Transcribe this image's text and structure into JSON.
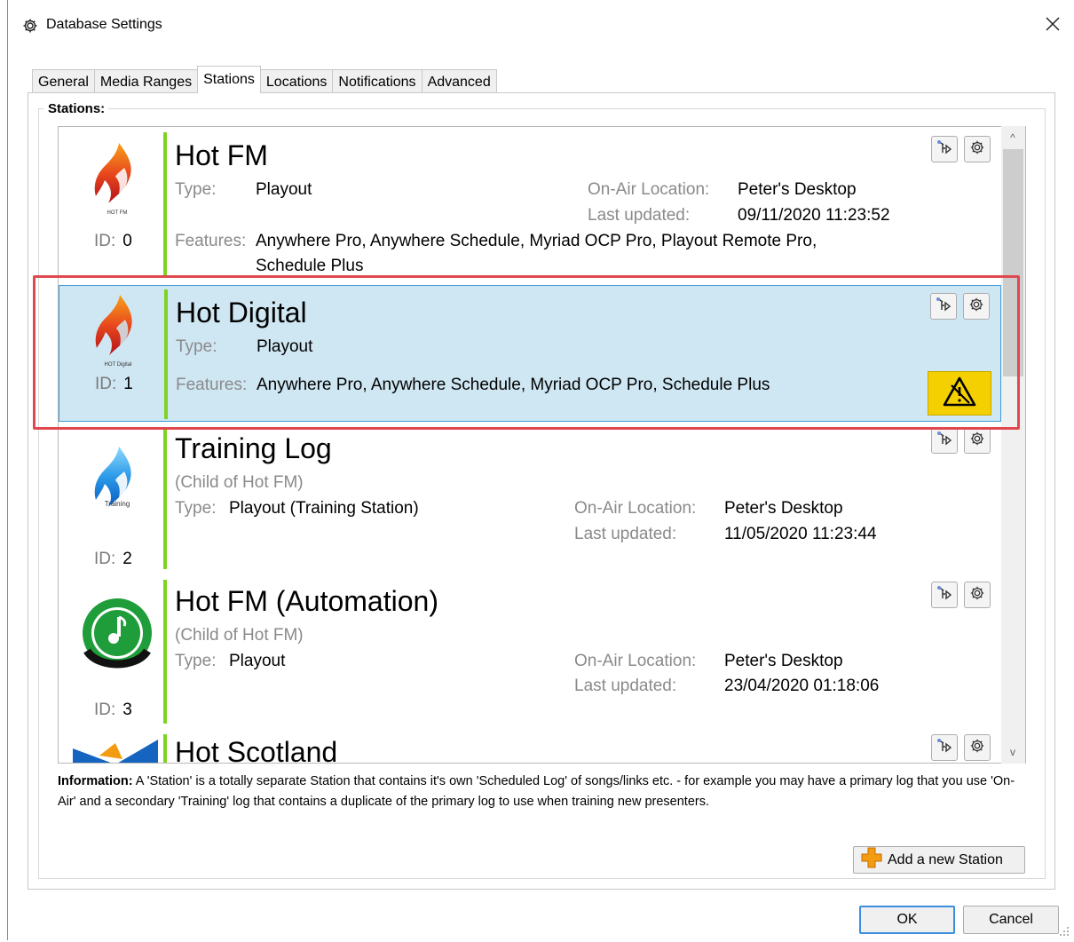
{
  "window": {
    "title": "Database Settings"
  },
  "tabs": [
    {
      "label": "General"
    },
    {
      "label": "Media Ranges"
    },
    {
      "label": "Stations"
    },
    {
      "label": "Locations"
    },
    {
      "label": "Notifications"
    },
    {
      "label": "Advanced"
    }
  ],
  "group_label": "Stations:",
  "labels": {
    "id": "ID:",
    "type": "Type:",
    "features": "Features:",
    "onair_location": "On-Air Location:",
    "last_updated": "Last updated:"
  },
  "stations": [
    {
      "name": "Hot FM",
      "logo_caption": "HOT FM",
      "id": "0",
      "type": "Playout",
      "onair_location": "Peter's Desktop",
      "last_updated": "09/11/2020 11:23:52",
      "features_line1": "Anywhere Pro, Anywhere Schedule, Myriad OCP Pro, Playout Remote Pro,",
      "features_line2": "Schedule Plus"
    },
    {
      "name": "Hot Digital",
      "logo_caption": "HOT Digital",
      "id": "1",
      "type": "Playout",
      "features_line1": "Anywhere Pro, Anywhere Schedule, Myriad OCP Pro, Schedule Plus",
      "selected": true,
      "warning": true
    },
    {
      "name": "Training Log",
      "child_of": "(Child of Hot FM)",
      "logo_caption": "Training",
      "id": "2",
      "type": "Playout (Training Station)",
      "onair_location": "Peter's Desktop",
      "last_updated": "11/05/2020 11:23:44"
    },
    {
      "name": "Hot FM (Automation)",
      "child_of": "(Child of Hot FM)",
      "id": "3",
      "type": "Playout",
      "onair_location": "Peter's Desktop",
      "last_updated": "23/04/2020 01:18:06"
    },
    {
      "name": "Hot Scotland"
    }
  ],
  "info": {
    "label": "Information:",
    "text": " A 'Station' is a totally separate Station that contains it's own 'Scheduled Log' of songs/links etc. - for example you may have a primary log that you use 'On-Air' and a secondary 'Training' log that contains a duplicate of the primary log to use when training new presenters."
  },
  "buttons": {
    "add_station": "Add a new Station",
    "ok": "OK",
    "cancel": "Cancel"
  },
  "icons": {
    "title": "gear-icon",
    "close": "close-icon",
    "playout": "playout-icon",
    "settings": "settings-gear-icon",
    "warning": "warning-icon",
    "add": "plus-icon"
  },
  "colors": {
    "accent_green": "#7ed321",
    "selected_row": "#cfe7f3",
    "selected_border": "#3d9bd6",
    "highlight_red": "#e0494f",
    "warning_yellow": "#f5d000",
    "ok_border": "#3d8ee0"
  }
}
